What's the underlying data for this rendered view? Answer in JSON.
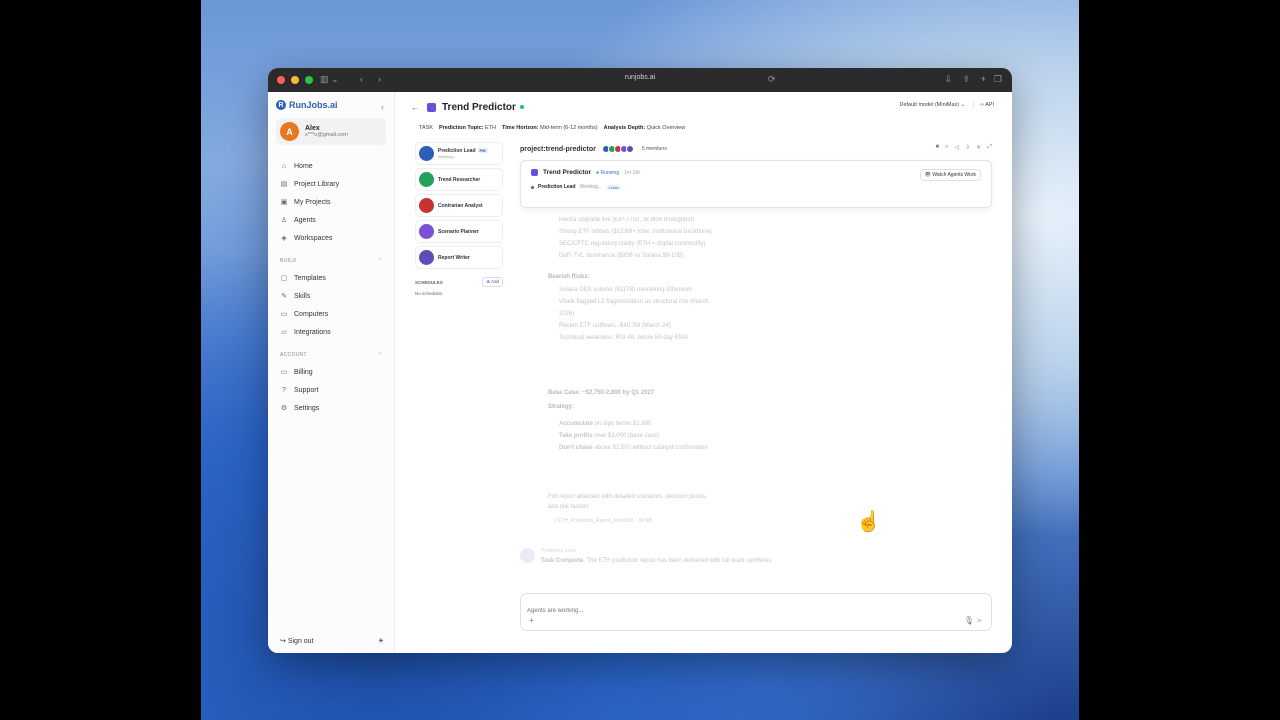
{
  "browser": {
    "url": "runjobs.ai"
  },
  "sidebar": {
    "logo": "RunJobs.ai",
    "user": {
      "initial": "A",
      "name": "Alex",
      "email": "s***o@gmail.com"
    },
    "nav": [
      {
        "label": "Home",
        "icon": "home-icon",
        "glyph": "⌂"
      },
      {
        "label": "Project Library",
        "icon": "book-icon",
        "glyph": "▤"
      },
      {
        "label": "My Projects",
        "icon": "folder-icon",
        "glyph": "▣"
      },
      {
        "label": "Agents",
        "icon": "agent-icon",
        "glyph": "♙"
      },
      {
        "label": "Workspaces",
        "icon": "layers-icon",
        "glyph": "◈"
      }
    ],
    "build_label": "BUILD",
    "build": [
      {
        "label": "Templates",
        "icon": "template-icon",
        "glyph": "▢"
      },
      {
        "label": "Skills",
        "icon": "wrench-icon",
        "glyph": "✎"
      },
      {
        "label": "Computers",
        "icon": "computer-icon",
        "glyph": "▭"
      },
      {
        "label": "Integrations",
        "icon": "plug-icon",
        "glyph": "▱"
      }
    ],
    "account_label": "ACCOUNT",
    "account": [
      {
        "label": "Billing",
        "icon": "card-icon",
        "glyph": "▭"
      },
      {
        "label": "Support",
        "icon": "help-icon",
        "glyph": "?"
      },
      {
        "label": "Settings",
        "icon": "gear-icon",
        "glyph": "⚙"
      }
    ],
    "signout": "Sign out"
  },
  "header": {
    "title": "Trend Predictor",
    "model": "Default model (MiniMax)",
    "api": "API"
  },
  "task": {
    "label": "TASK",
    "topic_key": "Prediction Topic:",
    "topic_val": "ETH",
    "horizon_key": "Time Horizon:",
    "horizon_val": "Mid-term (6-12 months)",
    "depth_key": "Analysis Depth:",
    "depth_val": "Quick Overview"
  },
  "agents": [
    {
      "name": "Prediction Lead",
      "sub": "Working...",
      "pm": "PM",
      "color": "#2b5fb8"
    },
    {
      "name": "Trend Researcher",
      "sub": "",
      "pm": "",
      "color": "#22a35a"
    },
    {
      "name": "Contrarian Analyst",
      "sub": "",
      "pm": "",
      "color": "#c83232"
    },
    {
      "name": "Scenario Planner",
      "sub": "",
      "pm": "",
      "color": "#7b4fd8"
    },
    {
      "name": "Report Writer",
      "sub": "",
      "pm": "",
      "color": "#5a4fb8"
    }
  ],
  "schedules": {
    "label": "SCHEDULES",
    "add": "Add",
    "empty": "No schedules"
  },
  "chat": {
    "channel": "project:trend-predictor",
    "members": "5 members",
    "run": {
      "title": "Trend Predictor",
      "status": "Running",
      "elapsed": "1m 18s",
      "watch": "Watch Agents Work",
      "agent": "Prediction Lead",
      "agent_status": "Working...",
      "task_tag": "1 task"
    },
    "bullish": [
      "Pectra upgrade live (EIP-7702, 3x blob throughput)",
      "Strong ETF inflows ($12.6B+ total, institutional backbone)",
      "SEC/CFTC regulatory clarity (ETH = digital commodity)",
      "DeFi TVL dominance ($85B vs Solana $9-10B)"
    ],
    "bearish_label": "Bearish Risks:",
    "bearish": [
      "Solana DEX volume ($117B) overtaking Ethereum",
      "Vitalik flagged L2 fragmentation as structural risk (March",
      "2026)",
      "Recent ETF outflows: -$40.7M (March 24)",
      "Technical weakness: RSI 48, below 50-day EMA"
    ],
    "base_case": "Base Case: ~$2,750-2,800 by Q1 2027",
    "strategy_label": "Strategy:",
    "strategy": [
      {
        "bold": "Accumulate",
        "rest": " on dips below $1,900"
      },
      {
        "bold": "Take profits",
        "rest": " near $3,000 (base case)"
      },
      {
        "bold": "Don't chase",
        "rest": " above $2,500 without catalyst confirmation"
      }
    ],
    "report_note": "Full report attached with detailed scenarios, decision points,",
    "report_note2": "and risk factors",
    "attachment": "ETH_Prediction_Report_March20...",
    "attachment_size": "52 KB",
    "completion_author": "Prediction Lead",
    "completion_bold": "Task Complete.",
    "completion_text": " The ETH prediction report has been delivered with full team synthesis.",
    "composer_placeholder": "Agents are working..."
  }
}
